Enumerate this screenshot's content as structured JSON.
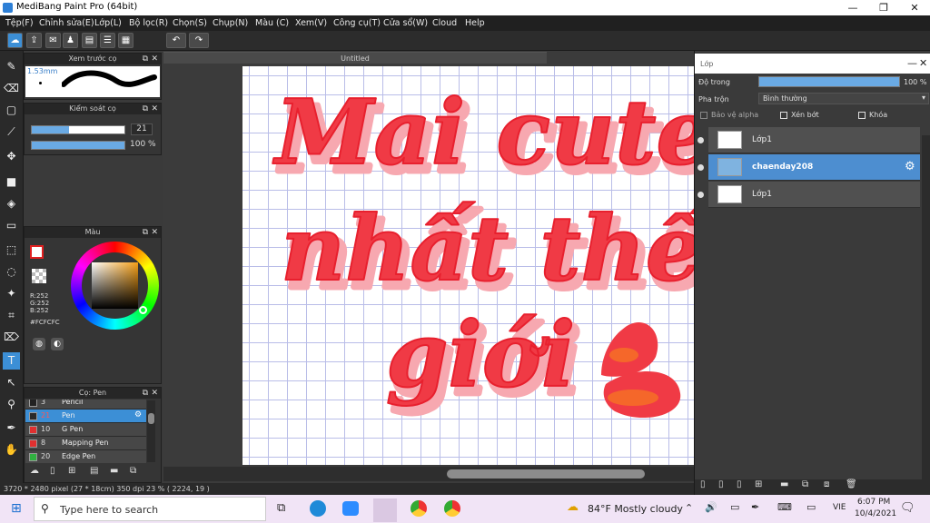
{
  "window": {
    "title": "MediBang Paint Pro (64bit)",
    "min": "—",
    "max": "❐",
    "close": "✕"
  },
  "menu": [
    "Tệp(F)",
    "Chỉnh sửa(E)",
    "Lớp(L)",
    "Bộ lọc(R)",
    "Chọn(S)",
    "Chụp(N)",
    "Màu (C)",
    "Xem(V)",
    "Công cụ(T)",
    "Cửa sổ(W)",
    "Cloud",
    "Help"
  ],
  "document": {
    "tab": "Untitled",
    "status": "3720 * 2480 pixel   (27 * 18cm)   350 dpi   23 %   ( 2224, 19 )"
  },
  "brush_preview": {
    "title": "Xem trước cọ",
    "size_label": "1.53mm"
  },
  "brush_control": {
    "title": "Kiểm soát cọ",
    "size": "21",
    "opacity": "100 %",
    "size_fraction": 0.4,
    "opacity_fraction": 1.0
  },
  "color_panel": {
    "title": "Màu",
    "r": "R:252",
    "g": "G:252",
    "b": "B:252",
    "hex": "#FCFCFC"
  },
  "brush_panel": {
    "title": "Cọ: Pen",
    "items": [
      {
        "num": "3",
        "name": "Pencil",
        "color": "#222222",
        "selected": false
      },
      {
        "num": "21",
        "name": "Pen",
        "color": "#3a8fd9",
        "selected": true
      },
      {
        "num": "10",
        "name": "G Pen",
        "color": "#e03030",
        "selected": false
      },
      {
        "num": "8",
        "name": "Mapping Pen",
        "color": "#e03030",
        "selected": false
      },
      {
        "num": "20",
        "name": "Edge Pen",
        "color": "#30b040",
        "selected": false
      }
    ]
  },
  "layer_panel": {
    "title": "Lớp",
    "opacity_label": "Độ trong",
    "opacity_value": "100 %",
    "blend_label": "Pha trộn",
    "blend_value": "Bình thường",
    "protect_alpha": "Bảo vệ alpha",
    "clipping": "Xén bớt",
    "lock": "Khóa",
    "layers": [
      {
        "name": "Lớp1",
        "selected": false
      },
      {
        "name": "chaenday208",
        "selected": true
      },
      {
        "name": "Lớp1",
        "selected": false
      }
    ]
  },
  "canvas_art": {
    "line1": "Mai cute",
    "line2": "nhất thế",
    "line3": "giới"
  },
  "taskbar": {
    "search_placeholder": "Type here to search",
    "weather": "84°F  Mostly cloudy",
    "lang": "VIE",
    "time": "6:07 PM",
    "date": "10/4/2021"
  },
  "colors": {
    "accent": "#4d8ed0",
    "art_red": "#f03a45",
    "art_pink": "#f7a8b0"
  }
}
